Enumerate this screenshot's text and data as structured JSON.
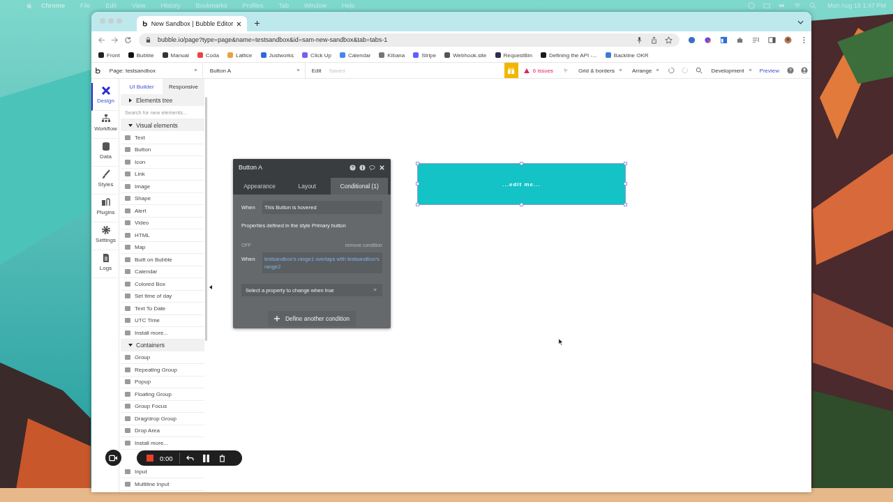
{
  "menubar": {
    "app": "Chrome",
    "menus": [
      "File",
      "Edit",
      "View",
      "History",
      "Bookmarks",
      "Profiles",
      "Tab",
      "Window",
      "Help"
    ],
    "clock": "Mon Aug 15  1:47 PM"
  },
  "browser": {
    "tab_title": "New Sandbox | Bubble Editor",
    "url": "bubble.io/page?type=page&name=testsandbox&id=sam-new-sandbox&tab=tabs-1",
    "bookmarks": [
      {
        "label": "Front",
        "color": "#222222"
      },
      {
        "label": "Bubble",
        "color": "#111111"
      },
      {
        "label": "Manual",
        "color": "#333333"
      },
      {
        "label": "Coda",
        "color": "#e8453c"
      },
      {
        "label": "Lattice",
        "color": "#e9a23b"
      },
      {
        "label": "Justworks",
        "color": "#2b6bd8"
      },
      {
        "label": "Click Up",
        "color": "#7b5cf0"
      },
      {
        "label": "Calendar",
        "color": "#4285f4"
      },
      {
        "label": "Kibana",
        "color": "#777777"
      },
      {
        "label": "Stripe",
        "color": "#635bff"
      },
      {
        "label": "Webhook.site",
        "color": "#555555"
      },
      {
        "label": "RequestBin",
        "color": "#2d2d4f"
      },
      {
        "label": "Defining the API -...",
        "color": "#1a1a1a"
      },
      {
        "label": "Backline OKR",
        "color": "#3a7bd5"
      }
    ]
  },
  "editor_toolbar": {
    "page": "Page: testsandbox",
    "element": "Button A",
    "edit": "Edit",
    "saved": "Saved",
    "issues": "6 issues",
    "grid": "Grid & borders",
    "arrange": "Arrange",
    "mode": "Development",
    "preview": "Preview"
  },
  "rail": [
    {
      "label": "Design",
      "selected": true
    },
    {
      "label": "Workflow",
      "selected": false
    },
    {
      "label": "Data",
      "selected": false
    },
    {
      "label": "Styles",
      "selected": false
    },
    {
      "label": "Plugins",
      "selected": false
    },
    {
      "label": "Settings",
      "selected": false
    },
    {
      "label": "Logs",
      "selected": false
    }
  ],
  "palette": {
    "tabs": [
      {
        "label": "UI Builder",
        "selected": true
      },
      {
        "label": "Responsive",
        "selected": false
      }
    ],
    "tree": {
      "title": "Elements tree",
      "expanded": false
    },
    "search_placeholder": "Search for new elements...",
    "sections": [
      {
        "title": "Visual elements",
        "expanded": true,
        "items": [
          "Text",
          "Button",
          "Icon",
          "Link",
          "Image",
          "Shape",
          "Alert",
          "Video",
          "HTML",
          "Map",
          "Built on Bubble",
          "Calendar",
          "Colored Box",
          "Set time of day",
          "Text To Date",
          "UTC Time",
          "Install more..."
        ]
      },
      {
        "title": "Containers",
        "expanded": true,
        "items": [
          "Group",
          "Repeating Group",
          "Popup",
          "Floating Group",
          "Group Focus",
          "Drag/drop Group",
          "Drop Area",
          "Install more..."
        ]
      },
      {
        "expanded": true,
        "items": [
          "Input",
          "Multiline Input"
        ]
      }
    ]
  },
  "property_panel": {
    "title": "Button A",
    "tabs": [
      {
        "label": "Appearance",
        "selected": false
      },
      {
        "label": "Layout",
        "selected": false
      },
      {
        "label": "Conditional (1)",
        "selected": true
      }
    ],
    "conditions": [
      {
        "label": "When",
        "when": "This Button is hovered",
        "expression": false,
        "note": "Properties defined in the style Primary button"
      },
      {
        "status": "OFF",
        "remove": "remove condition",
        "label": "When",
        "when": "testsandbox's range1 overlaps with testsandbox's range2",
        "expression": true,
        "select": "Select a property to change when true"
      }
    ],
    "add_button": "Define another condition"
  },
  "canvas_button": {
    "label": "...edit me..."
  },
  "recorder": {
    "time": "0:00"
  }
}
